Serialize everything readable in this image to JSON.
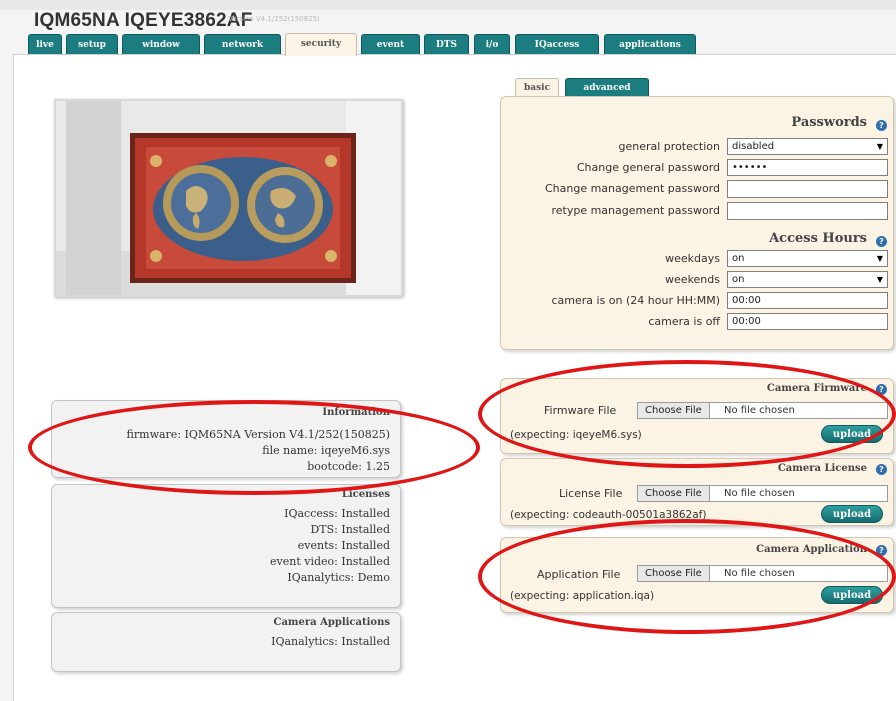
{
  "header": {
    "device_title": "IQM65NA IQEYE3862AF",
    "version": "Version V4.1/252(150825)"
  },
  "tabs": [
    {
      "label": "live"
    },
    {
      "label": "setup"
    },
    {
      "label": "window"
    },
    {
      "label": "network"
    },
    {
      "label": "security",
      "active": true
    },
    {
      "label": "event"
    },
    {
      "label": "DTS"
    },
    {
      "label": "i/o"
    },
    {
      "label": "IQaccess"
    },
    {
      "label": "applications"
    }
  ],
  "subtabs": {
    "basic": "basic",
    "advanced": "advanced"
  },
  "information": {
    "title": "Information",
    "firmware": "firmware: IQM65NA Version V4.1/252(150825)",
    "file_name": "file name: iqeyeM6.sys",
    "bootcode": "bootcode: 1.25"
  },
  "licenses": {
    "title": "Licenses",
    "items": [
      "IQaccess: Installed",
      "DTS: Installed",
      "events: Installed",
      "event video: Installed",
      "IQanalytics: Demo"
    ]
  },
  "camera_applications": {
    "title": "Camera Applications",
    "items": [
      "IQanalytics: Installed"
    ]
  },
  "passwords": {
    "title": "Passwords",
    "general_protection_label": "general protection",
    "general_protection_value": "disabled",
    "change_general_label": "Change general password",
    "change_general_value": "••••••",
    "change_mgmt_label": "Change management password",
    "retype_mgmt_label": "retype management password"
  },
  "access_hours": {
    "title": "Access Hours",
    "weekdays_label": "weekdays",
    "weekdays_value": "on",
    "weekends_label": "weekends",
    "weekends_value": "on",
    "camera_on_label": "camera is on (24 hour HH:MM)",
    "camera_on_value": "00:00",
    "camera_off_label": "camera is off",
    "camera_off_value": "00:00"
  },
  "firmware_upload": {
    "title": "Camera Firmware",
    "file_label": "Firmware File",
    "choose": "Choose File",
    "no_file": "No file chosen",
    "expecting": "(expecting: iqeyeM6.sys)",
    "upload": "upload"
  },
  "license_upload": {
    "title": "Camera License",
    "file_label": "License File",
    "choose": "Choose File",
    "no_file": "No file chosen",
    "expecting": "(expecting: codeauth-00501a3862af)",
    "upload": "upload"
  },
  "application_upload": {
    "title": "Camera Application",
    "file_label": "Application File",
    "choose": "Choose File",
    "no_file": "No file chosen",
    "expecting": "(expecting: application.iqa)",
    "upload": "upload"
  },
  "colors": {
    "tab_teal": "#1b7d80",
    "panel_beige": "#fbf3e4",
    "highlight_red": "#e01616"
  }
}
